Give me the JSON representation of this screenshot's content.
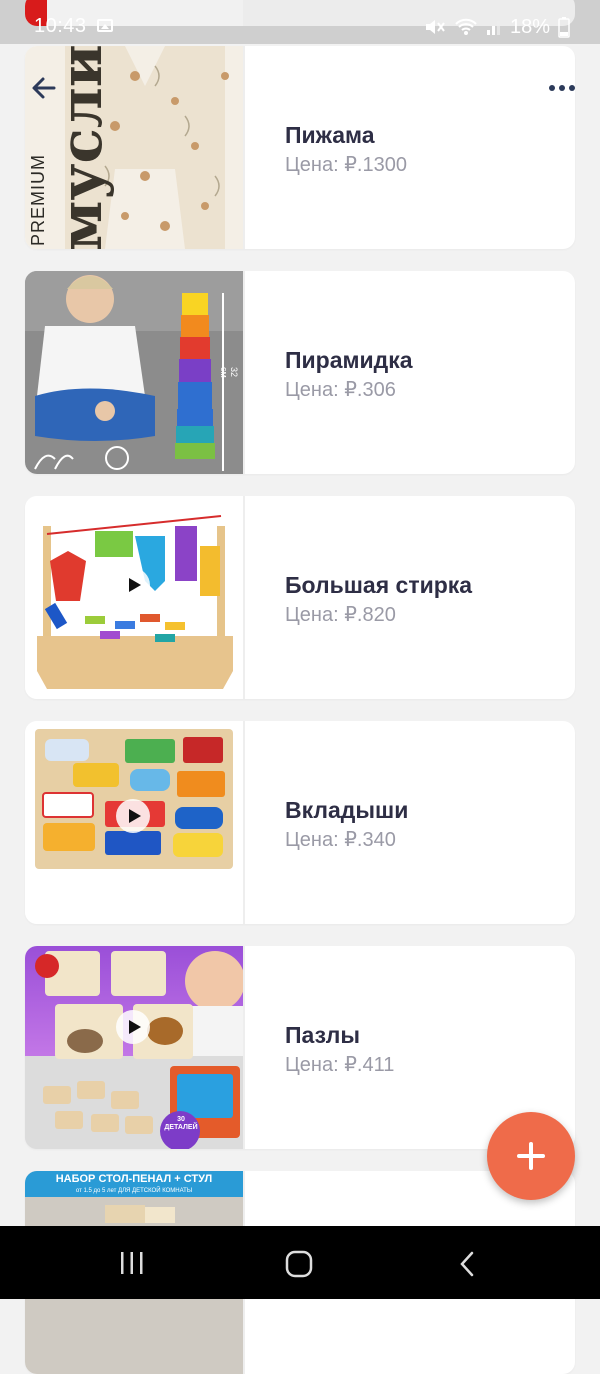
{
  "status_bar": {
    "time": "10:43",
    "battery": "18%"
  },
  "products": [
    {
      "name": "Пижама",
      "price": "Цена: ₽.1300",
      "has_video": false,
      "badge": "PREMIUM",
      "thumb_text": "муслин"
    },
    {
      "name": "Пирамидка",
      "price": "Цена: ₽.306",
      "has_video": false,
      "thumb_text": "32 см"
    },
    {
      "name": "Большая стирка",
      "price": "Цена: ₽.820",
      "has_video": true
    },
    {
      "name": "Вкладыши",
      "price": "Цена: ₽.340",
      "has_video": true
    },
    {
      "name": "Пазлы",
      "price": "Цена: ₽.411",
      "has_video": true,
      "thumb_text": "30 деталей"
    },
    {
      "name": "",
      "price": "",
      "has_video": false,
      "banner": "НАБОР СТОЛ-ПЕНАЛ + СТУЛ",
      "banner_sub": "от 1.5 до 5 лет ДЛЯ ДЕТСКОЙ КОМНАТЫ"
    }
  ],
  "colors": {
    "accent": "#ef6b4a",
    "title": "#2e2e45",
    "price": "#9a9aa6"
  }
}
